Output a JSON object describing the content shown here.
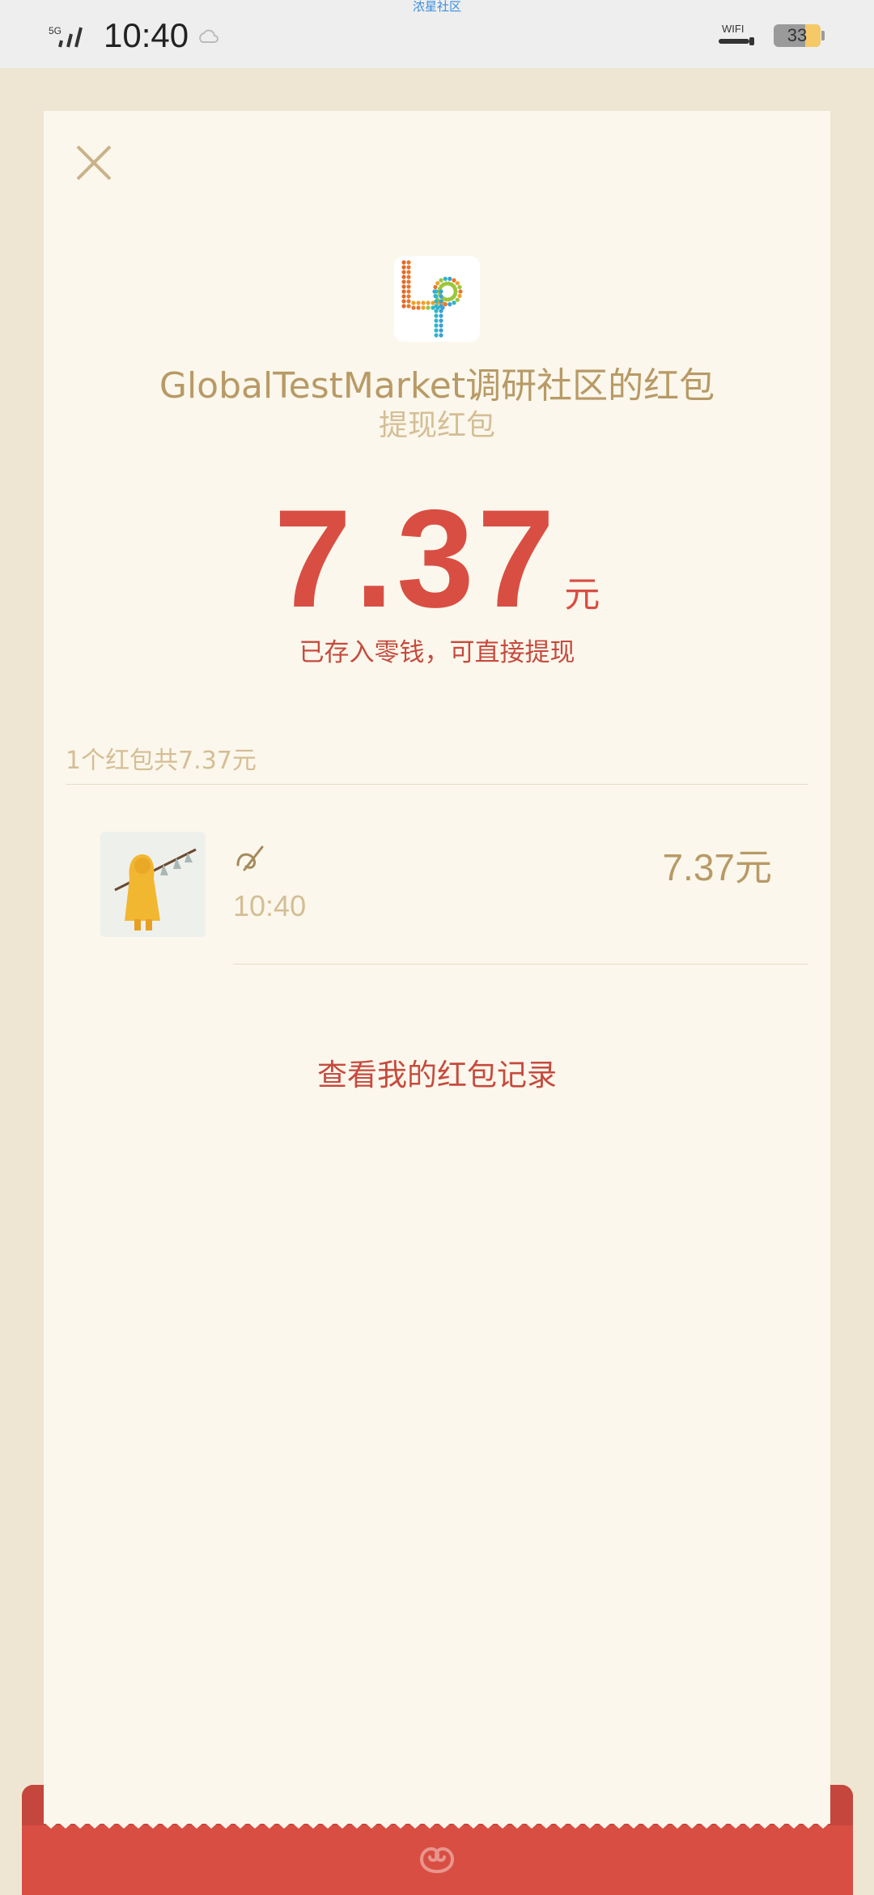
{
  "status_bar": {
    "top_hint": "浓星社区",
    "network": "5G",
    "time": "10:40",
    "wifi_label": "WIFI",
    "battery": "33",
    "battery_level": 0.33
  },
  "header": {
    "title": "GlobalTestMarket调研社区的红包",
    "subtitle": "提现红包"
  },
  "amount": {
    "value": "7.37",
    "unit": "元",
    "note": "已存入零钱，可直接提现"
  },
  "summary": "1个红包共7.37元",
  "records": [
    {
      "time": "10:40",
      "amount": "7.37元"
    }
  ],
  "footer": {
    "link_label": "查看我的红包记录"
  },
  "colors": {
    "accent_red": "#D94E43",
    "gold_text": "#B89A66",
    "card_bg": "#FBF7EC",
    "page_bg": "#EEE6D3"
  },
  "icons": [
    "close-icon",
    "app-logo-icon",
    "sender-signature-icon",
    "envelope-seal-icon"
  ]
}
